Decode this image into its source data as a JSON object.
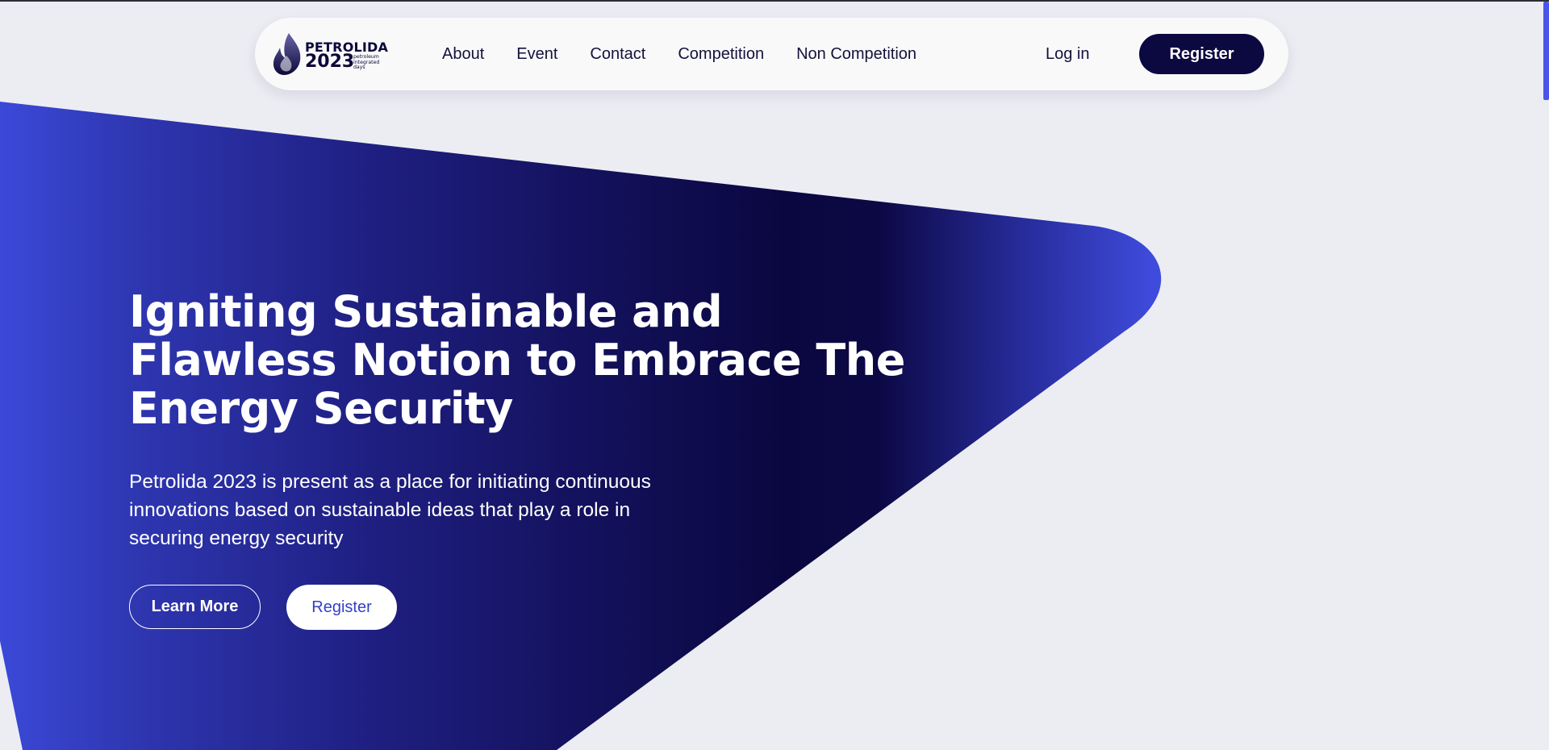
{
  "brand": {
    "name": "PETROLIDA",
    "year": "2023",
    "tagline": [
      "petroleum",
      "integrated",
      "days"
    ]
  },
  "nav": {
    "links": [
      "About",
      "Event",
      "Contact",
      "Competition",
      "Non Competition"
    ],
    "login_label": "Log in",
    "register_label": "Register"
  },
  "hero": {
    "title": "Igniting Sustainable and Flawless Notion to Embrace The Energy Security",
    "description": "Petrolida 2023 is present as a place for initiating continuous innovations based on sustainable ideas that play a role in securing energy security",
    "learn_more_label": "Learn More",
    "register_label": "Register"
  },
  "colors": {
    "background": "#ecedf3",
    "navy": "#0c0840",
    "accent_blue": "#3d49d8",
    "scrollbar": "#4b55e8"
  }
}
